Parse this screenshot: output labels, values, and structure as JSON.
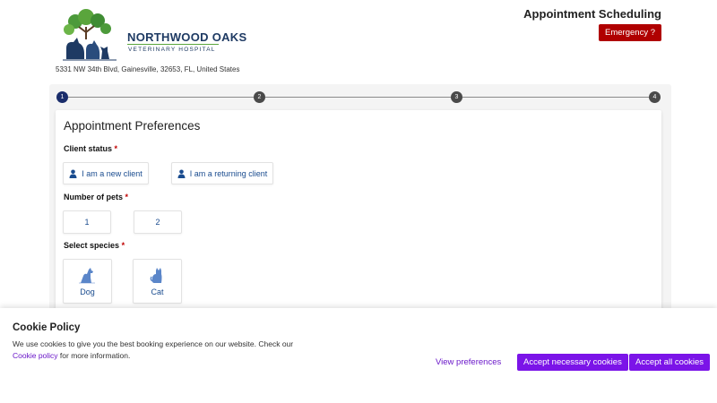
{
  "clinic": {
    "name": "NORTHWOOD OAKS",
    "subtitle": "VETERINARY HOSPITAL",
    "address": "5331 NW 34th Blvd, Gainesville, 32653, FL, United States"
  },
  "header": {
    "title": "Appointment Scheduling",
    "emergency_label": "Emergency ?"
  },
  "stepper": {
    "steps": [
      "1",
      "2",
      "3",
      "4"
    ],
    "current": 1
  },
  "form": {
    "title": "Appointment Preferences",
    "client_status": {
      "label": "Client status",
      "required_mark": "*",
      "options": [
        "I am a new client",
        "I am a returning client"
      ]
    },
    "number_of_pets": {
      "label": "Number of pets",
      "required_mark": "*",
      "options": [
        "1",
        "2"
      ]
    },
    "species": {
      "label": "Select species",
      "required_mark": "*",
      "options": [
        {
          "label": "Dog",
          "icon": "dog-icon"
        },
        {
          "label": "Cat",
          "icon": "cat-icon"
        }
      ]
    }
  },
  "cookie": {
    "title": "Cookie Policy",
    "text_before": "We use cookies to give you the best booking experience on our website. Check our",
    "link_text": "Cookie policy",
    "text_after": " for more information.",
    "view_preferences": "View preferences",
    "accept_necessary": "Accept necessary cookies",
    "accept_all": "Accept all cookies"
  },
  "colors": {
    "brand_navy": "#1e3a63",
    "emergency_red": "#b00000",
    "option_blue": "#1a4c8f",
    "cookie_purple": "#7b14e8"
  }
}
